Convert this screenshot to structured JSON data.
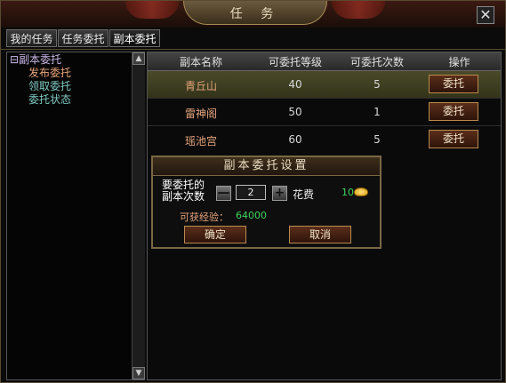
{
  "window": {
    "title": "任 务",
    "close_label": "✕"
  },
  "tabs": [
    {
      "label": "我的任务"
    },
    {
      "label": "任务委托"
    },
    {
      "label": "副本委托"
    }
  ],
  "tree": {
    "root_label": "副本委托",
    "children": [
      {
        "label": "发布委托"
      },
      {
        "label": "领取委托"
      },
      {
        "label": "委托状态"
      }
    ]
  },
  "table": {
    "headers": [
      "副本名称",
      "可委托等级",
      "可委托次数",
      "操作"
    ],
    "rows": [
      {
        "name": "青丘山",
        "level": "40",
        "times": "5",
        "action": "委托",
        "selected": true
      },
      {
        "name": "雷神阁",
        "level": "50",
        "times": "1",
        "action": "委托",
        "selected": false
      },
      {
        "name": "瑶池宫",
        "level": "60",
        "times": "5",
        "action": "委托",
        "selected": false
      }
    ]
  },
  "dialog": {
    "title": "副本委托设置",
    "count_label_line1": "要委托的",
    "count_label_line2": "副本次数",
    "minus_label": "—",
    "plus_label": "+",
    "count_value": "2",
    "cost_label": "花费",
    "cost_value": "10",
    "exp_label": "可获经验：",
    "exp_value": "64000",
    "confirm_label": "确定",
    "cancel_label": "取消"
  }
}
